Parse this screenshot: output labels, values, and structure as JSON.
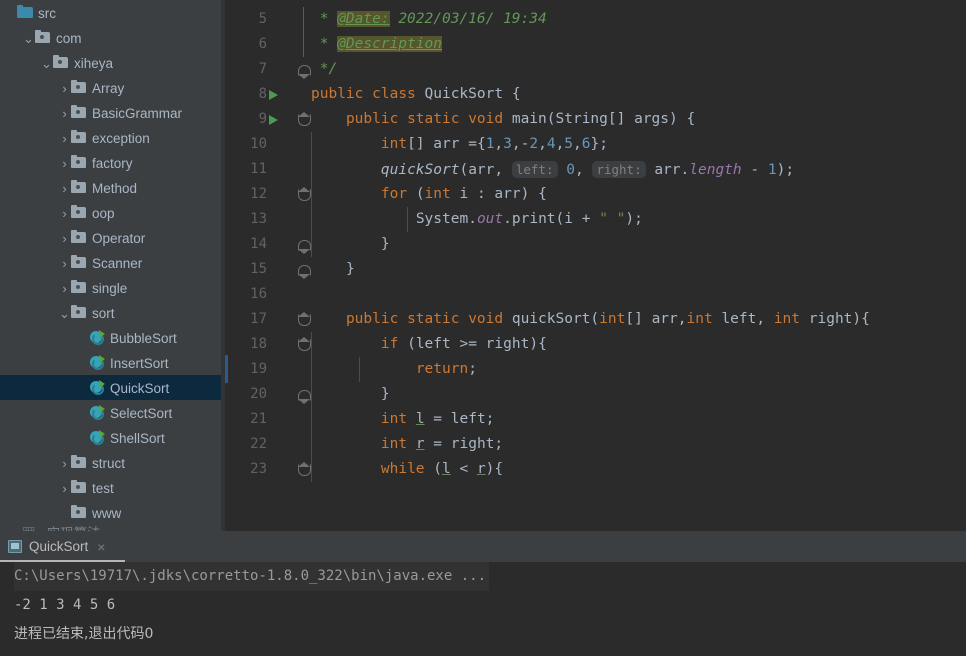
{
  "sidebar": {
    "scrollbar_present": true,
    "tree": [
      {
        "label": "src",
        "indent": 0,
        "chevron": "",
        "icon": "src-folder-icon",
        "selected": false
      },
      {
        "label": "com",
        "indent": 1,
        "chevron": "v",
        "icon": "package-folder-icon",
        "selected": false
      },
      {
        "label": "xiheya",
        "indent": 2,
        "chevron": "v",
        "icon": "package-folder-icon",
        "selected": false
      },
      {
        "label": "Array",
        "indent": 3,
        "chevron": ">",
        "icon": "package-folder-icon",
        "selected": false
      },
      {
        "label": "BasicGrammar",
        "indent": 3,
        "chevron": ">",
        "icon": "package-folder-icon",
        "selected": false
      },
      {
        "label": "exception",
        "indent": 3,
        "chevron": ">",
        "icon": "package-folder-icon",
        "selected": false
      },
      {
        "label": "factory",
        "indent": 3,
        "chevron": ">",
        "icon": "package-folder-icon",
        "selected": false
      },
      {
        "label": "Method",
        "indent": 3,
        "chevron": ">",
        "icon": "package-folder-icon",
        "selected": false
      },
      {
        "label": "oop",
        "indent": 3,
        "chevron": ">",
        "icon": "package-folder-icon",
        "selected": false
      },
      {
        "label": "Operator",
        "indent": 3,
        "chevron": ">",
        "icon": "package-folder-icon",
        "selected": false
      },
      {
        "label": "Scanner",
        "indent": 3,
        "chevron": ">",
        "icon": "package-folder-icon",
        "selected": false
      },
      {
        "label": "single",
        "indent": 3,
        "chevron": ">",
        "icon": "package-folder-icon",
        "selected": false
      },
      {
        "label": "sort",
        "indent": 3,
        "chevron": "v",
        "icon": "package-folder-icon",
        "selected": false
      },
      {
        "label": "BubbleSort",
        "indent": 4,
        "chevron": "",
        "icon": "java-class-icon",
        "selected": false
      },
      {
        "label": "InsertSort",
        "indent": 4,
        "chevron": "",
        "icon": "java-class-icon",
        "selected": false
      },
      {
        "label": "QuickSort",
        "indent": 4,
        "chevron": "",
        "icon": "java-class-icon",
        "selected": true
      },
      {
        "label": "SelectSort",
        "indent": 4,
        "chevron": "",
        "icon": "java-class-icon",
        "selected": false
      },
      {
        "label": "ShellSort",
        "indent": 4,
        "chevron": "",
        "icon": "java-class-icon",
        "selected": false
      },
      {
        "label": "struct",
        "indent": 3,
        "chevron": ">",
        "icon": "package-folder-icon",
        "selected": false
      },
      {
        "label": "test",
        "indent": 3,
        "chevron": ">",
        "icon": "package-folder-icon",
        "selected": false
      },
      {
        "label": "www",
        "indent": 3,
        "chevron": "",
        "icon": "package-folder-icon",
        "selected": false
      }
    ]
  },
  "editor": {
    "first_visible_line": 5,
    "last_visible_line": 23,
    "lines": [
      {
        "num": 5,
        "run_marker": false,
        "fold": "",
        "text": " * @Date: 2022/03/16/ 19:34"
      },
      {
        "num": 6,
        "run_marker": false,
        "fold": "",
        "text": " * @Description"
      },
      {
        "num": 7,
        "run_marker": false,
        "fold": "end",
        "text": " */"
      },
      {
        "num": 8,
        "run_marker": true,
        "fold": "",
        "text": "public class QuickSort {"
      },
      {
        "num": 9,
        "run_marker": true,
        "fold": "top",
        "text": "    public static void main(String[] args) {"
      },
      {
        "num": 10,
        "run_marker": false,
        "fold": "",
        "text": "        int[] arr ={1,3,-2,4,5,6};"
      },
      {
        "num": 11,
        "run_marker": false,
        "fold": "",
        "text": "        quickSort(arr, left: 0, right: arr.length - 1);"
      },
      {
        "num": 12,
        "run_marker": false,
        "fold": "top",
        "text": "        for (int i : arr) {"
      },
      {
        "num": 13,
        "run_marker": false,
        "fold": "",
        "text": "            System.out.print(i + \" \");"
      },
      {
        "num": 14,
        "run_marker": false,
        "fold": "end",
        "text": "        }"
      },
      {
        "num": 15,
        "run_marker": false,
        "fold": "end",
        "text": "    }"
      },
      {
        "num": 16,
        "run_marker": false,
        "fold": "",
        "text": ""
      },
      {
        "num": 17,
        "run_marker": false,
        "fold": "top",
        "text": "    public static void quickSort(int[] arr,int left, int right){"
      },
      {
        "num": 18,
        "run_marker": false,
        "fold": "top",
        "text": "        if (left >= right){"
      },
      {
        "num": 19,
        "run_marker": false,
        "fold": "",
        "text": "            return;"
      },
      {
        "num": 20,
        "run_marker": false,
        "fold": "end",
        "text": "        }"
      },
      {
        "num": 21,
        "run_marker": false,
        "fold": "",
        "text": "        int l = left;"
      },
      {
        "num": 22,
        "run_marker": false,
        "fold": "",
        "text": "        int r = right;"
      },
      {
        "num": 23,
        "run_marker": false,
        "fold": "top",
        "text": "        while (l < r){"
      }
    ],
    "param_hints": [
      "left:",
      "right:"
    ],
    "javadoc_tags": [
      "@Date:",
      "@Description"
    ]
  },
  "console": {
    "tab_label": "QuickSort",
    "tab_close": "×",
    "command_line": "C:\\Users\\19717\\.jdks\\corretto-1.8.0_322\\bin\\java.exe ...",
    "program_output": "-2 1 3 4 5 6",
    "exit_message": "进程已结束,退出代码0"
  },
  "colors": {
    "editor_bg": "#2b2b2b",
    "panel_bg": "#3c3f41",
    "selection_bg": "#0d293e",
    "keyword": "#cc7832",
    "number": "#6897bb",
    "string": "#6a8759",
    "comment": "#629755",
    "method": "#ffc66d",
    "field": "#9876aa",
    "text": "#a9b7c6",
    "line_number": "#606366",
    "run_arrow": "#499c54",
    "javadoc_tag_bg": "#57552c"
  }
}
